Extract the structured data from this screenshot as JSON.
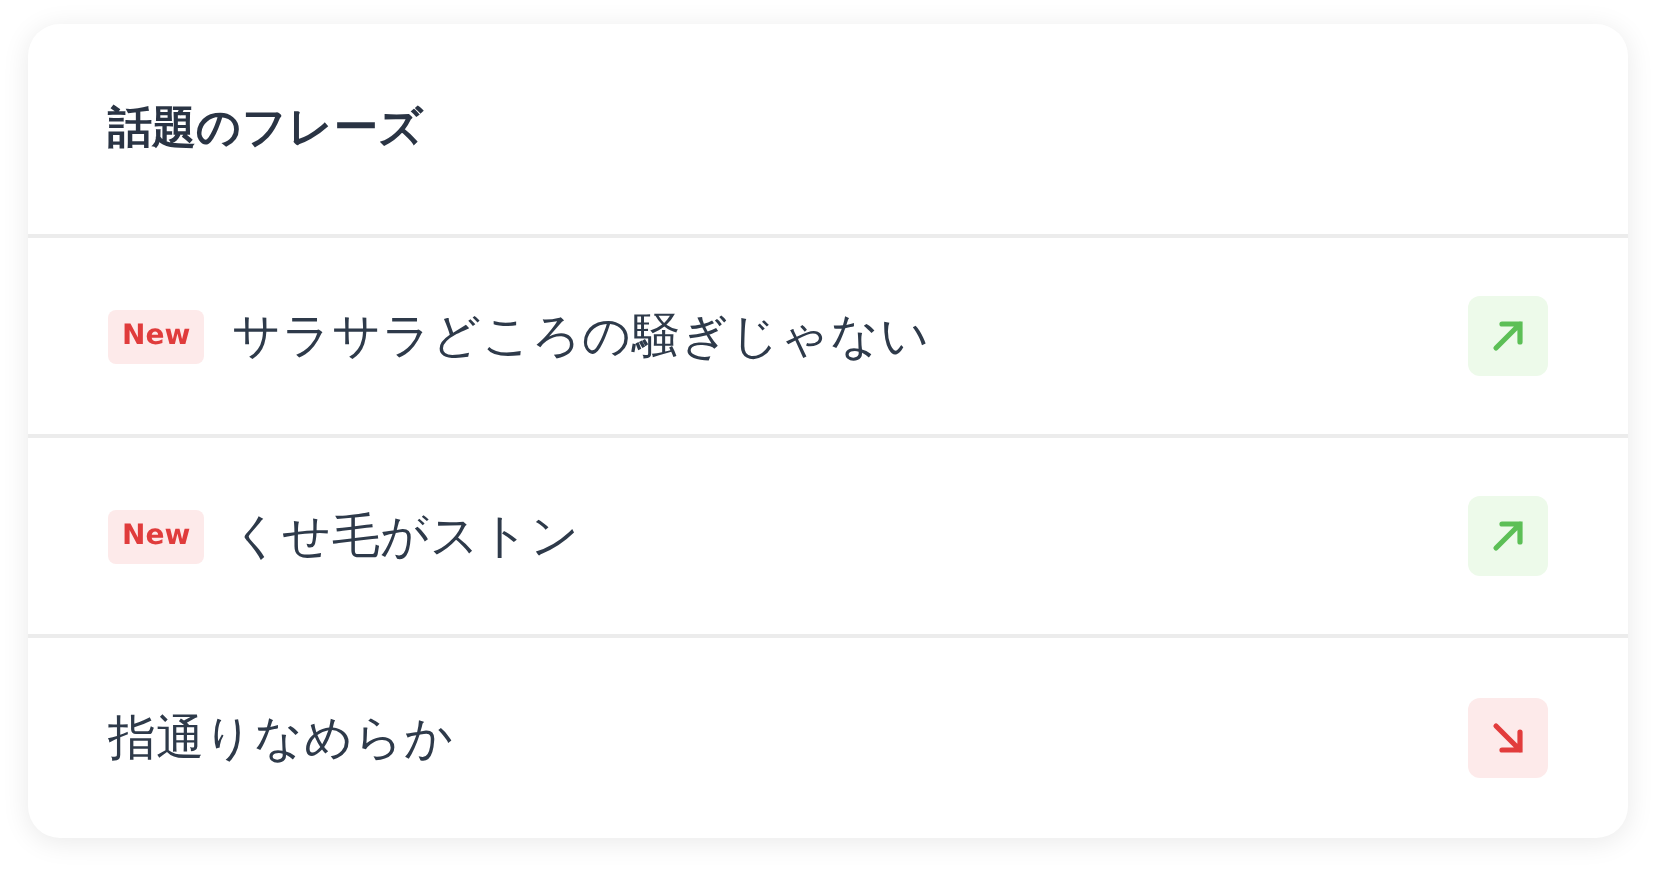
{
  "title": "話題のフレーズ",
  "phrases": [
    {
      "badge": "New",
      "text": "サラサラどころの騒ぎじゃない",
      "rising": true
    },
    {
      "badge": "New",
      "text": "くせ毛がストン",
      "rising": true
    },
    {
      "text": "指通りなめらか",
      "rising": false
    }
  ]
}
